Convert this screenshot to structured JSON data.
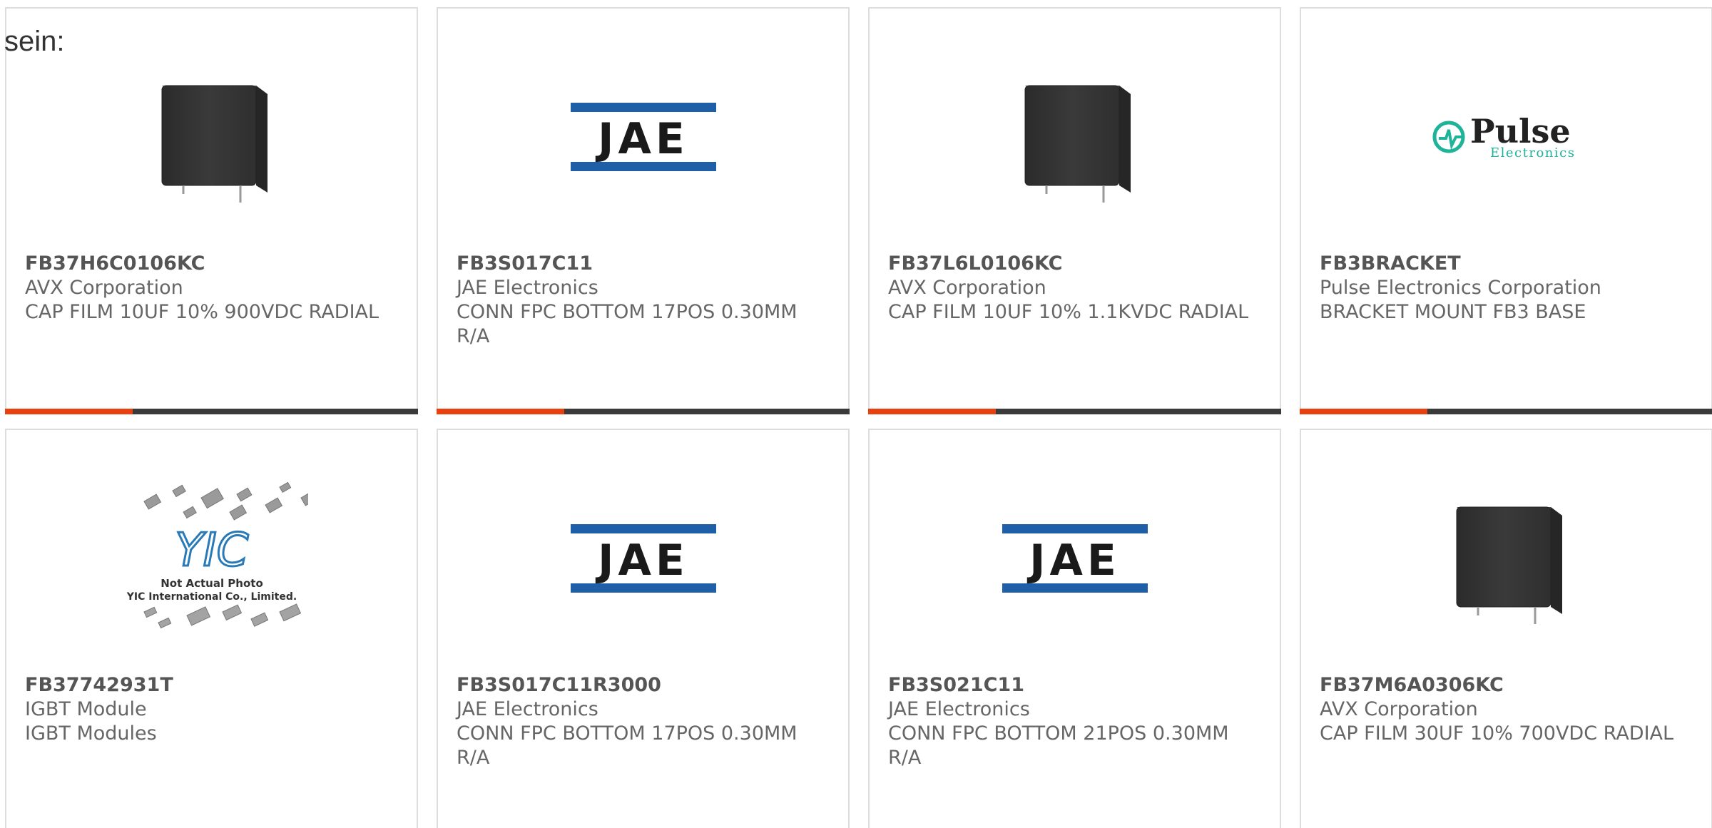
{
  "intro_text": "sein:",
  "colors": {
    "accent": "#e8400f",
    "bar_track": "#3a3a3a",
    "card_border": "#dddddd",
    "jae_blue": "#1e5fa8",
    "pulse_teal": "#1fb39a"
  },
  "products": [
    {
      "part_number": "FB37H6C0106KC",
      "manufacturer": "AVX Corporation",
      "description": "CAP FILM 10UF 10% 900VDC RADIAL",
      "image": "capacitor-photo",
      "progress": 0.31
    },
    {
      "part_number": "FB3S017C11",
      "manufacturer": "JAE Electronics",
      "description": "CONN FPC BOTTOM 17POS 0.30MM R/A",
      "image": "jae-logo",
      "logo_text": "JAE",
      "progress": 0.31
    },
    {
      "part_number": "FB37L6L0106KC",
      "manufacturer": "AVX Corporation",
      "description": "CAP FILM 10UF 10% 1.1KVDC RADIAL",
      "image": "capacitor-photo",
      "progress": 0.31
    },
    {
      "part_number": "FB3BRACKET",
      "manufacturer": "Pulse Electronics Corporation",
      "description": "BRACKET MOUNT FB3 BASE",
      "image": "pulse-logo",
      "logo_text": "Pulse",
      "logo_subtext": "Electronics",
      "progress": 0.31
    },
    {
      "part_number": "FB37742931T",
      "manufacturer": "IGBT Module",
      "description": "IGBT Modules",
      "image": "yic-not-actual-photo",
      "logo_text": "YIC",
      "photo_caption_1": "Not Actual Photo",
      "photo_caption_2": "YIC International Co., Limited."
    },
    {
      "part_number": "FB3S017C11R3000",
      "manufacturer": "JAE Electronics",
      "description": "CONN FPC BOTTOM 17POS 0.30MM R/A",
      "image": "jae-logo",
      "logo_text": "JAE"
    },
    {
      "part_number": "FB3S021C11",
      "manufacturer": "JAE Electronics",
      "description": "CONN FPC BOTTOM 21POS 0.30MM R/A",
      "image": "jae-logo",
      "logo_text": "JAE"
    },
    {
      "part_number": "FB37M6A0306KC",
      "manufacturer": "AVX Corporation",
      "description": "CAP FILM 30UF 10% 700VDC RADIAL",
      "image": "capacitor-photo"
    }
  ]
}
